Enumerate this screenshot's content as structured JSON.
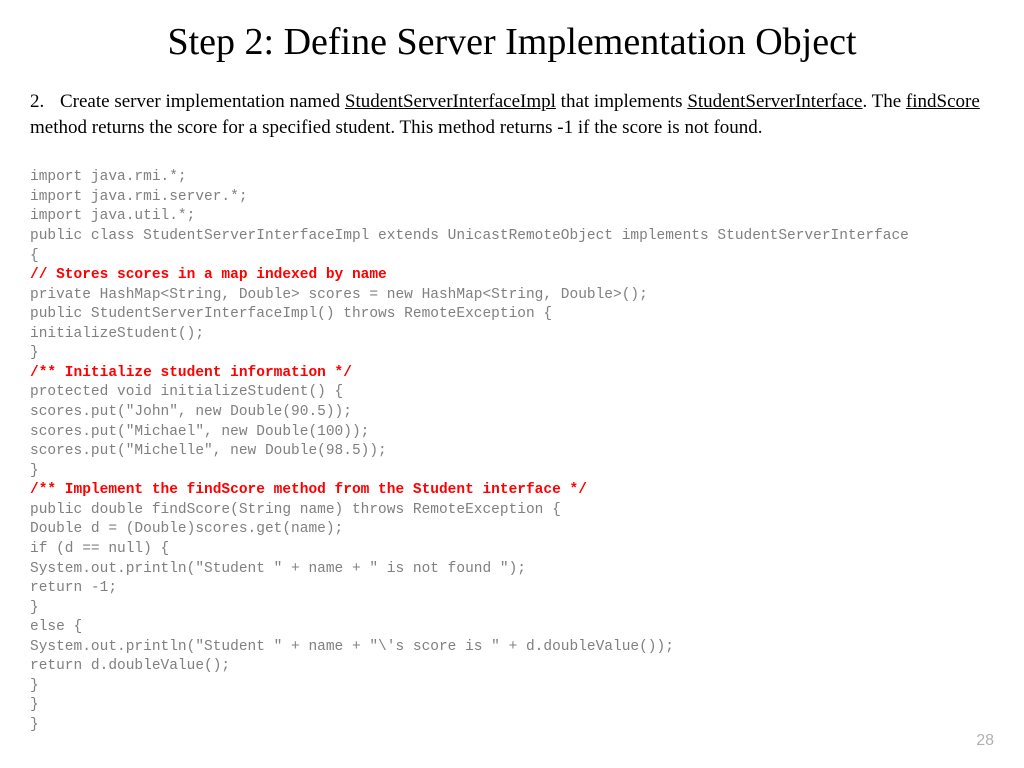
{
  "title": "Step 2: Define Server Implementation Object",
  "list_number": "2.",
  "desc_part1": "Create server implementation named ",
  "desc_underline1": "StudentServerInterfaceImpl",
  "desc_part2": " that implements ",
  "desc_underline2": "StudentServerInterface",
  "desc_part3": ". The ",
  "desc_underline3": "findScore",
  "desc_part4": " method returns the score for a specified student. This method returns -1 if the score is not found.",
  "code": {
    "line1": "import java.rmi.*;",
    "line2": "import java.rmi.server.*;",
    "line3": "import java.util.*;",
    "line4": "public class StudentServerInterfaceImpl extends UnicastRemoteObject implements StudentServerInterface",
    "line5": "{",
    "comment1": "// Stores scores in a map indexed by name",
    "line6": "private HashMap<String, Double> scores = new HashMap<String, Double>();",
    "line7": "public StudentServerInterfaceImpl() throws RemoteException {",
    "line8": "initializeStudent();",
    "line9": "}",
    "comment2": "/** Initialize student information */",
    "line10": "protected void initializeStudent() {",
    "line11": "scores.put(\"John\", new Double(90.5));",
    "line12": "scores.put(\"Michael\", new Double(100));",
    "line13": "scores.put(\"Michelle\", new Double(98.5));",
    "line14": "}",
    "comment3": "/** Implement the findScore method from the Student interface */",
    "line15": "public double findScore(String name) throws RemoteException {",
    "line16": "Double d = (Double)scores.get(name);",
    "line17": "if (d == null) {",
    "line18": "System.out.println(\"Student \" + name + \" is not found \");",
    "line19": "return -1;",
    "line20": "}",
    "line21": "else {",
    "line22": "System.out.println(\"Student \" + name + \"\\'s score is \" + d.doubleValue());",
    "line23": "return d.doubleValue();",
    "line24": "}",
    "line25": "}",
    "line26": "}"
  },
  "page_number": "28"
}
